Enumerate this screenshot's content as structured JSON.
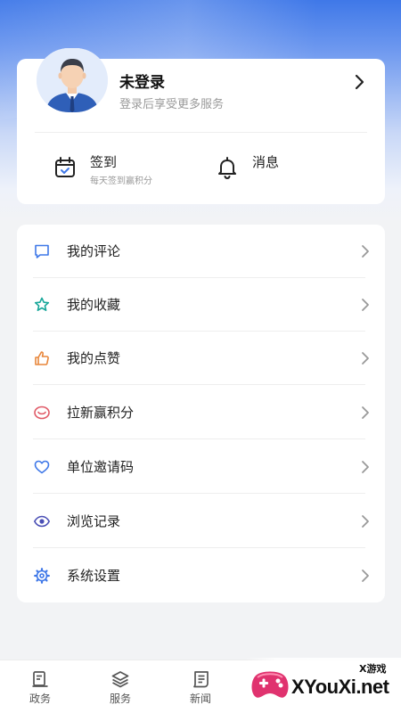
{
  "colors": {
    "accent": "#3f78e8",
    "card_bg": "#ffffff",
    "page_bg": "#f2f3f5",
    "text_primary": "#222222",
    "text_secondary": "#9a9a9a"
  },
  "profile": {
    "title": "未登录",
    "subtitle": "登录后享受更多服务",
    "avatar_icon": "user-avatar-icon",
    "chevron_icon": "chevron-right-icon"
  },
  "quick_actions": {
    "signin": {
      "title": "签到",
      "subtitle": "每天签到赢积分",
      "icon": "calendar-check-icon"
    },
    "messages": {
      "title": "消息",
      "icon": "bell-icon"
    }
  },
  "menu": {
    "items": [
      {
        "label": "我的评论",
        "icon": "comment-icon",
        "color": "#3f78e8"
      },
      {
        "label": "我的收藏",
        "icon": "star-icon",
        "color": "#19a79a"
      },
      {
        "label": "我的点赞",
        "icon": "thumb-up-icon",
        "color": "#e8863a"
      },
      {
        "label": "拉新赢积分",
        "icon": "eye-ring-icon",
        "color": "#e05a67"
      },
      {
        "label": "单位邀请码",
        "icon": "heart-icon",
        "color": "#3f78e8"
      },
      {
        "label": "浏览记录",
        "icon": "eye-icon",
        "color": "#4a4fb5"
      },
      {
        "label": "系统设置",
        "icon": "gear-icon",
        "color": "#3f78e8"
      }
    ]
  },
  "tabbar": {
    "tabs": [
      {
        "label": "政务",
        "icon": "government-icon"
      },
      {
        "label": "服务",
        "icon": "layers-icon"
      },
      {
        "label": "新闻",
        "icon": "newspaper-icon"
      }
    ]
  },
  "watermark": {
    "text": "XYouXi.net",
    "small": "X游戏"
  }
}
